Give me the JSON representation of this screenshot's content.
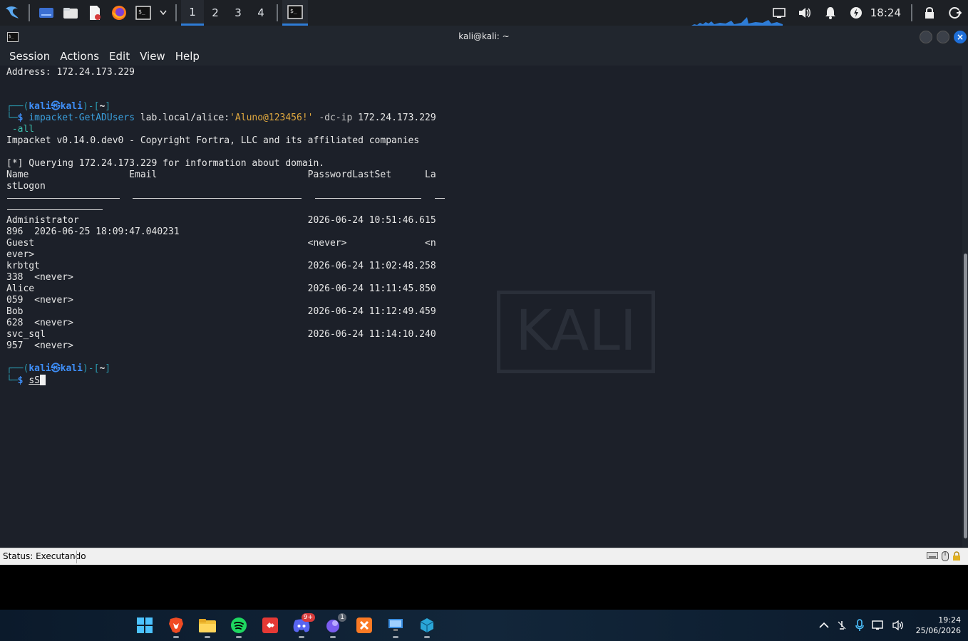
{
  "top_panel": {
    "workspaces": [
      "1",
      "2",
      "3",
      "4"
    ],
    "active_workspace": "1",
    "clock": "18:24"
  },
  "window": {
    "title": "kali@kali: ~",
    "menu": [
      "Session",
      "Actions",
      "Edit",
      "View",
      "Help"
    ]
  },
  "terminal": {
    "address_line": "Address: 172.24.173.229",
    "prompt_user": "kali",
    "prompt_host": "kali",
    "prompt_dir": "~",
    "cmd_name": "impacket-GetADUsers",
    "cmd_target": "lab.local/alice:",
    "cmd_password": "'Aluno@123456!'",
    "cmd_dcip_flag": "-dc-ip",
    "cmd_dcip_value": "172.24.173.229",
    "cmd_all_flag": "-all",
    "banner": "Impacket v0.14.0.dev0 - Copyright Fortra, LLC and its affiliated companies",
    "query_line": "[*] Querying 172.24.173.229 for information about domain.",
    "header_line1": "Name                  Email                           PasswordLastSet      La",
    "header_line2": "stLogon",
    "rows": [
      "Administrator                                         2026-06-24 10:51:46.615",
      "896  2026-06-25 18:09:47.040231",
      "Guest                                                 <never>              <n",
      "ever>",
      "krbtgt                                                2026-06-24 11:02:48.258",
      "338  <never>",
      "Alice                                                 2026-06-24 11:11:45.850",
      "059  <never>",
      "Bob                                                   2026-06-24 11:12:49.459",
      "628  <never>",
      "svc_sql                                               2026-06-24 11:14:10.240",
      "957  <never>"
    ],
    "current_input": "sS",
    "watermark": "KALI"
  },
  "statusbar": {
    "text": "Status: Executando"
  },
  "win_taskbar": {
    "discord_badge": "9+",
    "app_badge": "1",
    "time": "19:24",
    "date": "25/06/2026"
  },
  "colors": {
    "accent": "#2e7cd6",
    "prompt_blue": "#3e8ef7",
    "string_orange": "#e0a83f"
  }
}
